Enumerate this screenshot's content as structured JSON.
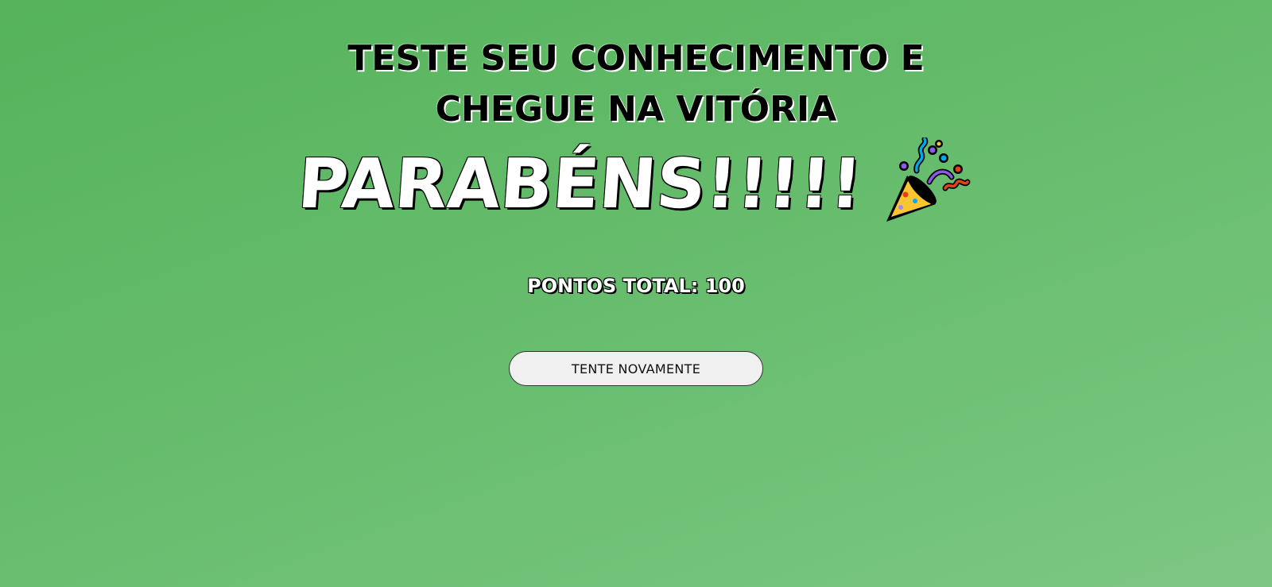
{
  "header": {
    "title_line1": "TESTE SEU CONHECIMENTO E",
    "title_line2": "CHEGUE NA VITÓRIA"
  },
  "result": {
    "congrats": "PARABÉNS!!!!!",
    "icon": "party-popper-icon",
    "score_label": "PONTOS TOTAL: 100"
  },
  "actions": {
    "retry_label": "TENTE NOVAMENTE"
  },
  "colors": {
    "background_start": "#55b35b",
    "background_end": "#7cc784",
    "button_background": "#f0f0f0"
  }
}
